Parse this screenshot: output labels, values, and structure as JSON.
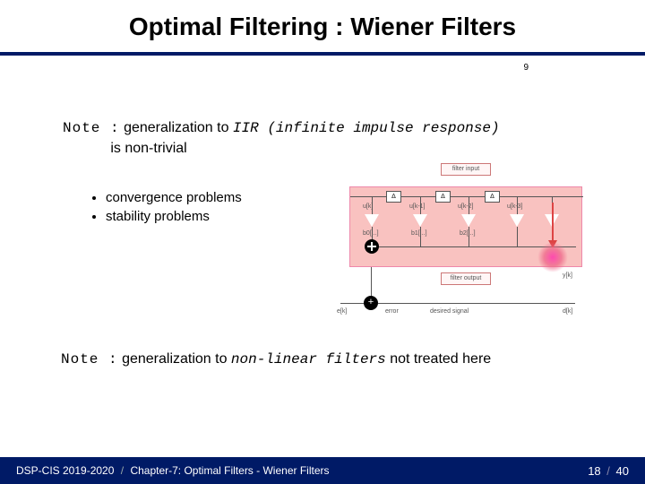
{
  "title": "Optimal Filtering : Wiener Filters",
  "subpage": "9",
  "note1": {
    "label": "Note :",
    "text1": "generalization to ",
    "iir": "IIR (infinite impulse response)",
    "text2": "is non-trivial"
  },
  "bullets": [
    "convergence problems",
    "stability problems"
  ],
  "note2": {
    "label": "Note :",
    "text1": "generalization to ",
    "nl": "non-linear filters",
    "text2": " not treated here"
  },
  "diagram": {
    "input_label": "filter input",
    "delay_label": "Δ",
    "u_labels": [
      "u[k]",
      "u[k-1]",
      "u[k-2]",
      "u[k-3]"
    ],
    "b_labels": [
      "b0[...]",
      "b1[...]",
      "b2[...]"
    ],
    "output_label": "filter output",
    "error_label": "error",
    "desired_label": "desired signal",
    "y_label": "y[k]",
    "e_label": "e[k]",
    "d_label": "d[k]",
    "plus": "+"
  },
  "footer": {
    "course": "DSP-CIS 2019-2020",
    "chapter": "Chapter-7: Optimal Filters - Wiener Filters",
    "page": "18",
    "total": "40"
  }
}
